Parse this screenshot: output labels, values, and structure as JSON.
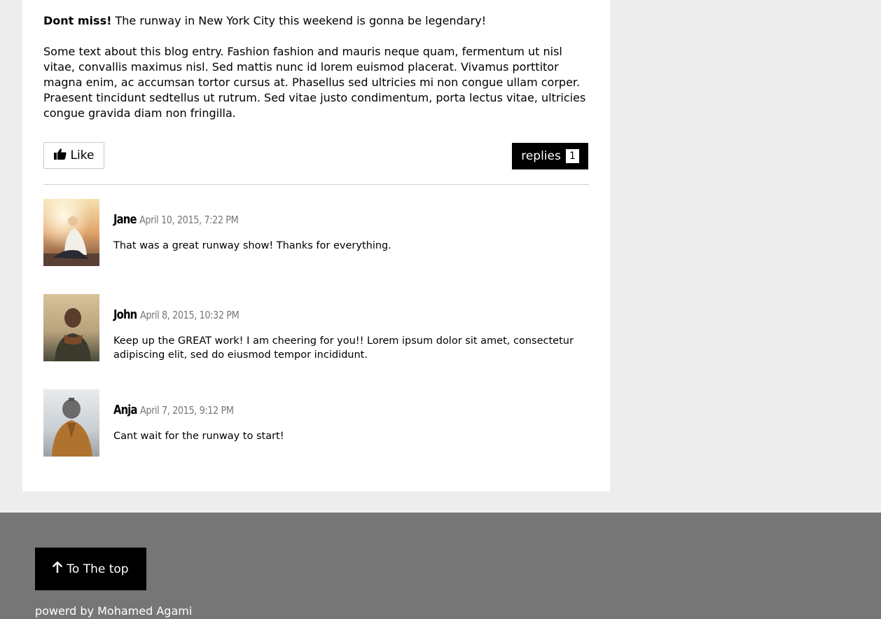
{
  "post": {
    "intro_bold": "Dont miss!",
    "intro_rest": " The runway in New York City this weekend is gonna be legendary!",
    "body": "Some text about this blog entry. Fashion fashion and mauris neque quam, fermentum ut nisl vitae, convallis maximus nisl. Sed mattis nunc id lorem euismod placerat. Vivamus porttitor magna enim, ac accumsan tortor cursus at. Phasellus sed ultricies mi non congue ullam corper. Praesent tincidunt sedtellus ut rutrum. Sed vitae justo condimentum, porta lectus vitae, ultricies congue gravida diam non fringilla."
  },
  "actions": {
    "like_label": "Like",
    "like_icon": "thumbs-up-icon",
    "replies_label": "replies",
    "replies_count": "1"
  },
  "comments": [
    {
      "name": "Jane",
      "date": "April 10, 2015, 7:22 PM",
      "text": "That was a great runway show! Thanks for everything."
    },
    {
      "name": "John",
      "date": "April 8, 2015, 10:32 PM",
      "text": "Keep up the GREAT work! I am cheering for you!! Lorem ipsum dolor sit amet, consectetur adipiscing elit, sed do eiusmod tempor incididunt."
    },
    {
      "name": "Anja",
      "date": "April 7, 2015, 9:12 PM",
      "text": "Cant wait for the runway to start!"
    }
  ],
  "footer": {
    "top_button_label": "To The top",
    "top_button_icon": "arrow-up-icon",
    "powered_by": "powerd by Mohamed Agami"
  },
  "colors": {
    "page_bg": "#ededed",
    "card_bg": "#ffffff",
    "footer_bg": "#767676",
    "button_dark": "#000000",
    "date_text": "#777777"
  }
}
